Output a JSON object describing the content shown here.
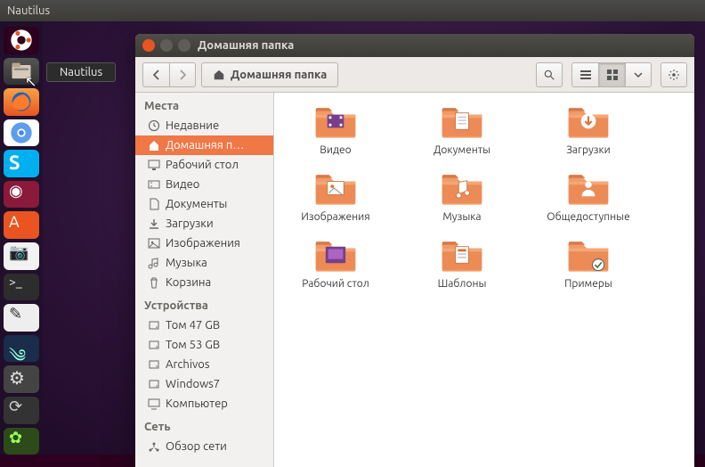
{
  "top_panel": {
    "app_name": "Nautilus"
  },
  "tooltip": "Nautilus",
  "window": {
    "title": "Домашняя папка",
    "path_button": "Домашняя папка"
  },
  "sidebar": {
    "sections": {
      "places": "Места",
      "devices": "Устройства",
      "network": "Сеть"
    },
    "places": [
      {
        "label": "Недавние",
        "icon": "clock"
      },
      {
        "label": "Домашняя п…",
        "icon": "home",
        "selected": true
      },
      {
        "label": "Рабочий стол",
        "icon": "desktop"
      },
      {
        "label": "Видео",
        "icon": "video"
      },
      {
        "label": "Документы",
        "icon": "doc"
      },
      {
        "label": "Загрузки",
        "icon": "download"
      },
      {
        "label": "Изображения",
        "icon": "image"
      },
      {
        "label": "Музыка",
        "icon": "music"
      },
      {
        "label": "Корзина",
        "icon": "trash"
      }
    ],
    "devices": [
      {
        "label": "Том 47 GB",
        "icon": "disk"
      },
      {
        "label": "Том 53 GB",
        "icon": "disk"
      },
      {
        "label": "Archivos",
        "icon": "disk"
      },
      {
        "label": "Windows7",
        "icon": "disk"
      },
      {
        "label": "Компьютер",
        "icon": "computer"
      }
    ],
    "network": [
      {
        "label": "Обзор сети",
        "icon": "network"
      }
    ]
  },
  "folders": [
    {
      "label": "Видео",
      "emblem": "video"
    },
    {
      "label": "Документы",
      "emblem": "doc"
    },
    {
      "label": "Загрузки",
      "emblem": "download"
    },
    {
      "label": "Изображения",
      "emblem": "image"
    },
    {
      "label": "Музыка",
      "emblem": "music"
    },
    {
      "label": "Общедоступные",
      "emblem": "public"
    },
    {
      "label": "Рабочий стол",
      "emblem": "desktop"
    },
    {
      "label": "Шаблоны",
      "emblem": "template"
    },
    {
      "label": "Примеры",
      "emblem": "link"
    }
  ]
}
